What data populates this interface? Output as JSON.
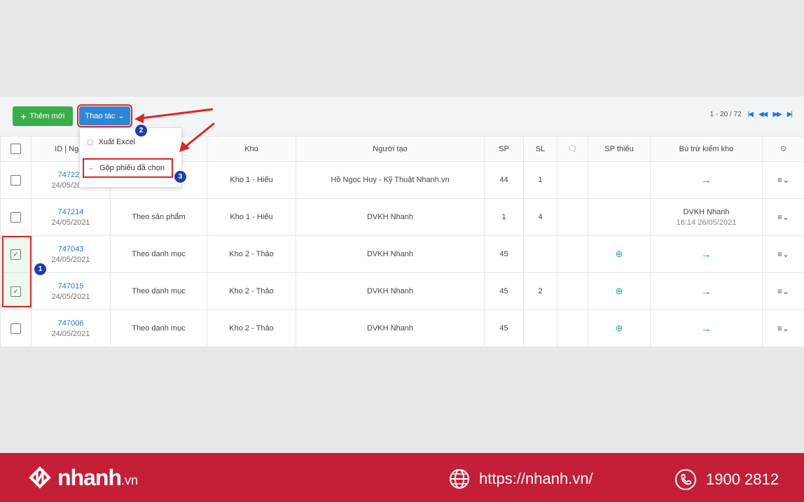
{
  "toolbar": {
    "add_label": "Thêm mới",
    "actions_label": "Thao tác",
    "pager_text": "1 - 20 / 72"
  },
  "dropdown": {
    "items": [
      {
        "label": "Xuất Excel",
        "icon": "file-icon"
      },
      {
        "label": "Gộp phiếu đã chọn",
        "icon": "merge-icon"
      }
    ]
  },
  "table": {
    "headers": [
      "",
      "ID | Ngày",
      "",
      "Kho",
      "Người tạo",
      "SP",
      "SL",
      "",
      "SP thiếu",
      "Bù trừ kiểm kho",
      ""
    ],
    "rows": [
      {
        "checked": false,
        "id": "747221",
        "date": "24/05/2021",
        "type": "",
        "kho": "Kho 1 - Hiếu",
        "nguoi_tao": "Hồ Ngọc Huy - Kỹ Thuật Nhanh.vn",
        "sp": "44",
        "sl": "1",
        "sp_thieu": false,
        "bu_tru": "arrow"
      },
      {
        "checked": false,
        "id": "747214",
        "date": "24/05/2021",
        "type": "Theo sản phẩm",
        "kho": "Kho 1 - Hiếu",
        "nguoi_tao": "DVKH Nhanh",
        "sp": "1",
        "sl": "4",
        "sp_thieu": false,
        "bu_tru_name": "DVKH Nhanh",
        "bu_tru_time": "16:14 26/05/2021"
      },
      {
        "checked": true,
        "id": "747043",
        "date": "24/05/2021",
        "type": "Theo danh mục",
        "kho": "Kho 2 - Thảo",
        "nguoi_tao": "DVKH Nhanh",
        "sp": "45",
        "sl": "",
        "sp_thieu": true,
        "bu_tru": "arrow"
      },
      {
        "checked": true,
        "id": "747015",
        "date": "24/05/2021",
        "type": "Theo danh mục",
        "kho": "Kho 2 - Thảo",
        "nguoi_tao": "DVKH Nhanh",
        "sp": "45",
        "sl": "2",
        "sp_thieu": true,
        "bu_tru": "arrow"
      },
      {
        "checked": false,
        "id": "747006",
        "date": "24/05/2021",
        "type": "Theo danh mục",
        "kho": "Kho 2 - Thảo",
        "nguoi_tao": "DVKH Nhanh",
        "sp": "45",
        "sl": "",
        "sp_thieu": true,
        "bu_tru": "arrow"
      }
    ]
  },
  "badges": [
    "1",
    "2",
    "3"
  ],
  "footer": {
    "logo_main": "nhanh",
    "logo_sub": ".vn",
    "website": "https://nhanh.vn/",
    "phone": "1900 2812"
  },
  "colors": {
    "accent_blue": "#2f86d8",
    "add_green": "#3aae49",
    "highlight_red": "#e02424",
    "footer_red": "#c41f37"
  }
}
